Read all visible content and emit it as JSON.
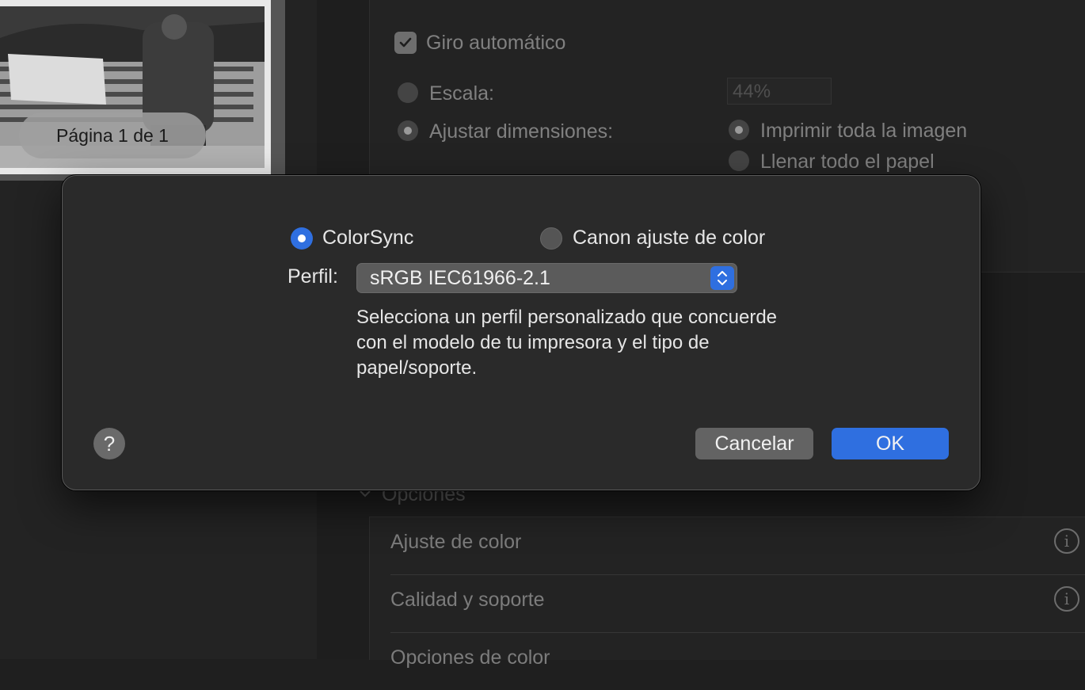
{
  "preview": {
    "page_indicator": "Página 1 de 1"
  },
  "background_settings": {
    "auto_rotate": {
      "label": "Giro automático",
      "checked": true
    },
    "scale": {
      "label": "Escala:",
      "value": "44%",
      "selected": false
    },
    "fit": {
      "label": "Ajustar dimensiones:",
      "selected": true
    },
    "fit_options": [
      {
        "label": "Imprimir toda la imagen",
        "selected": true
      },
      {
        "label": "Llenar todo el papel",
        "selected": false
      }
    ],
    "options_section": {
      "title": "Opciones",
      "rows": [
        {
          "label": "Ajuste de color"
        },
        {
          "label": "Calidad y soporte"
        },
        {
          "label": "Opciones de color"
        }
      ]
    }
  },
  "dialog": {
    "color_mode": {
      "colorsync": {
        "label": "ColorSync",
        "selected": true
      },
      "canon": {
        "label": "Canon ajuste de color",
        "selected": false
      }
    },
    "profile": {
      "label": "Perfil:",
      "value": "sRGB IEC61966-2.1"
    },
    "description": "Selecciona un perfil personalizado que concuerde con el modelo de tu impresora y el tipo de papel/soporte.",
    "help": "?",
    "buttons": {
      "cancel": "Cancelar",
      "ok": "OK"
    }
  },
  "colors": {
    "accent": "#2f6fe0",
    "dialog_bg": "#2a2a2a",
    "window_bg": "#1f1f1f"
  }
}
